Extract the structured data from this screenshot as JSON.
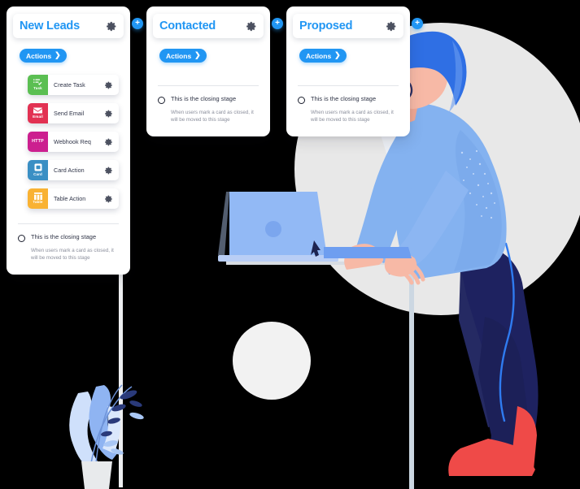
{
  "board": {
    "columns": [
      {
        "title": "New Leads",
        "gear_icon": "gear-icon",
        "actions_label": "Actions",
        "actions_chevron_icon": "chevron-right-icon",
        "action_items": [
          {
            "name": "Create Task",
            "badge": "Task",
            "color": "#5bbf52",
            "icon": "task-list-check-icon"
          },
          {
            "name": "Send Email",
            "badge": "Email",
            "color": "#e23152",
            "icon": "envelope-icon"
          },
          {
            "name": "Webhook Req",
            "badge": "HTTP",
            "color": "#cc1f8f",
            "icon": "http-text-icon"
          },
          {
            "name": "Card Action",
            "badge": "Card",
            "color": "#3a8fc4",
            "icon": "card-square-icon"
          },
          {
            "name": "Table Action",
            "badge": "Table",
            "color": "#f9b233",
            "icon": "table-grid-icon"
          }
        ],
        "closing": {
          "radio_icon": "radio-unchecked-icon",
          "title": "This is the closing stage",
          "description": "When users mark a card as closed, it will be moved to this stage"
        }
      },
      {
        "title": "Contacted",
        "gear_icon": "gear-icon",
        "actions_label": "Actions",
        "actions_chevron_icon": "chevron-right-icon",
        "action_items": [],
        "closing": {
          "radio_icon": "radio-unchecked-icon",
          "title": "This is the closing stage",
          "description": "When users mark a card as closed, it will be moved to this stage"
        }
      },
      {
        "title": "Proposed",
        "gear_icon": "gear-icon",
        "actions_label": "Actions",
        "actions_chevron_icon": "chevron-right-icon",
        "action_items": [],
        "closing": {
          "radio_icon": "radio-unchecked-icon",
          "title": "This is the closing stage",
          "description": "When users mark a card as closed, it will be moved to this stage"
        }
      }
    ],
    "add_column_buttons": [
      {
        "label": "+",
        "icon": "plus-circle-icon"
      },
      {
        "label": "+",
        "icon": "plus-circle-icon"
      },
      {
        "label": "+",
        "icon": "plus-circle-icon"
      }
    ]
  },
  "illustration": {
    "name": "person-working-at-laptop",
    "colors": {
      "backdrop_circle": "#e8e8e8",
      "small_circle": "#f2f2f2",
      "hair": "#2f6fe4",
      "skin": "#f7b9a6",
      "shirt": "#84b2f0",
      "shirt_collar": "#eef1f6",
      "tie": "#1d2451",
      "trousers": "#1e2260",
      "trouser_seam": "#2f7bf0",
      "shoe": "#ef4a48",
      "laptop": "#92b9f5",
      "laptop_base": "#6e9ef0",
      "desk": "#e7eaee",
      "pole": "#cfd8e2",
      "plant_leaf_dark": "#2a3a7a",
      "plant_leaf_light": "#8fb4f2",
      "plant_leaf_pale": "#cfe0fb",
      "pot": "#e8eaec"
    }
  }
}
